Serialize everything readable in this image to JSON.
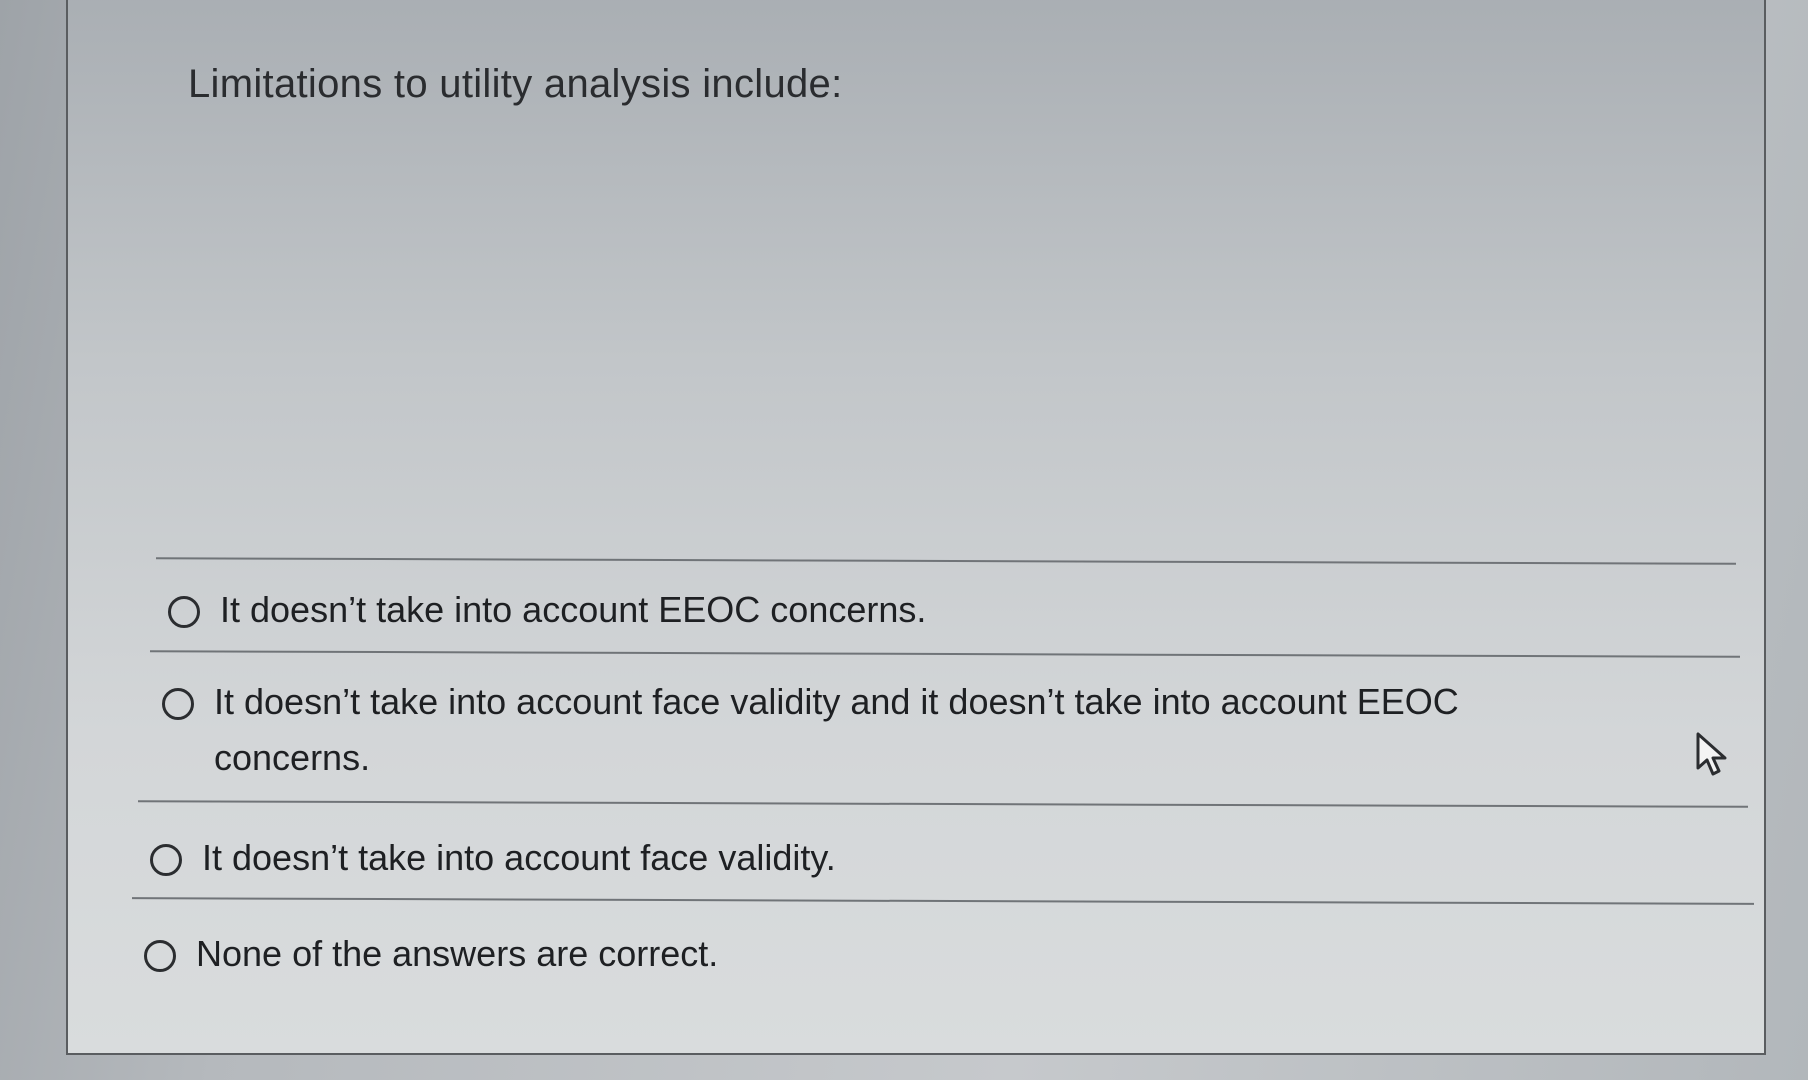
{
  "question": {
    "text": "Limitations to utility analysis include:"
  },
  "options": [
    {
      "label": "It doesn’t take into account EEOC concerns."
    },
    {
      "label": "It doesn’t take into account face validity and it doesn’t take into account EEOC concerns."
    },
    {
      "label": "It doesn’t take into account face validity."
    },
    {
      "label": "None of the answers are correct."
    }
  ],
  "icons": {
    "radio": "radio-button-icon",
    "cursor": "mouse-pointer-icon"
  }
}
